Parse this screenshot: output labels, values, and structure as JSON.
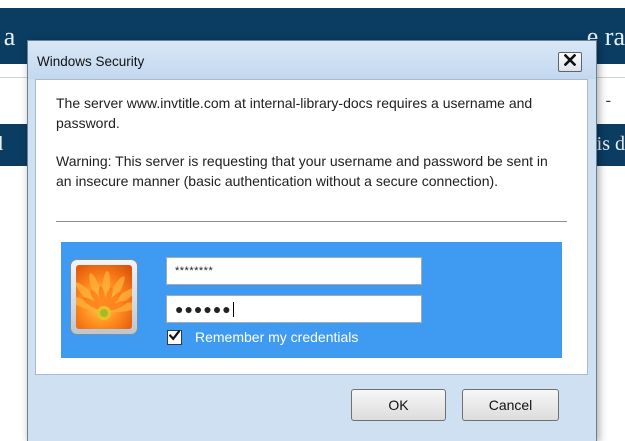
{
  "background_page": {
    "banner_left": "t a",
    "banner_right": "e ra",
    "dash": "-",
    "bar2_left": "l",
    "bar2_right": "is d",
    "colors": {
      "banner": "#0b3d63"
    }
  },
  "dialog": {
    "title": "Windows Security",
    "close_icon": "close-icon",
    "message": "The server www.invtitle.com at internal-library-docs requires a username and password.",
    "warning": "Warning: This server is requesting that your username and password be sent in an insecure manner (basic authentication without a secure connection).",
    "credentials": {
      "avatar_icon": "user-avatar-flower",
      "username_value": "********",
      "password_value": "●●●●●●",
      "remember_checked": true,
      "remember_label": "Remember my credentials",
      "panel_color": "#3f9bf2"
    },
    "buttons": {
      "ok_label": "OK",
      "cancel_label": "Cancel"
    }
  }
}
